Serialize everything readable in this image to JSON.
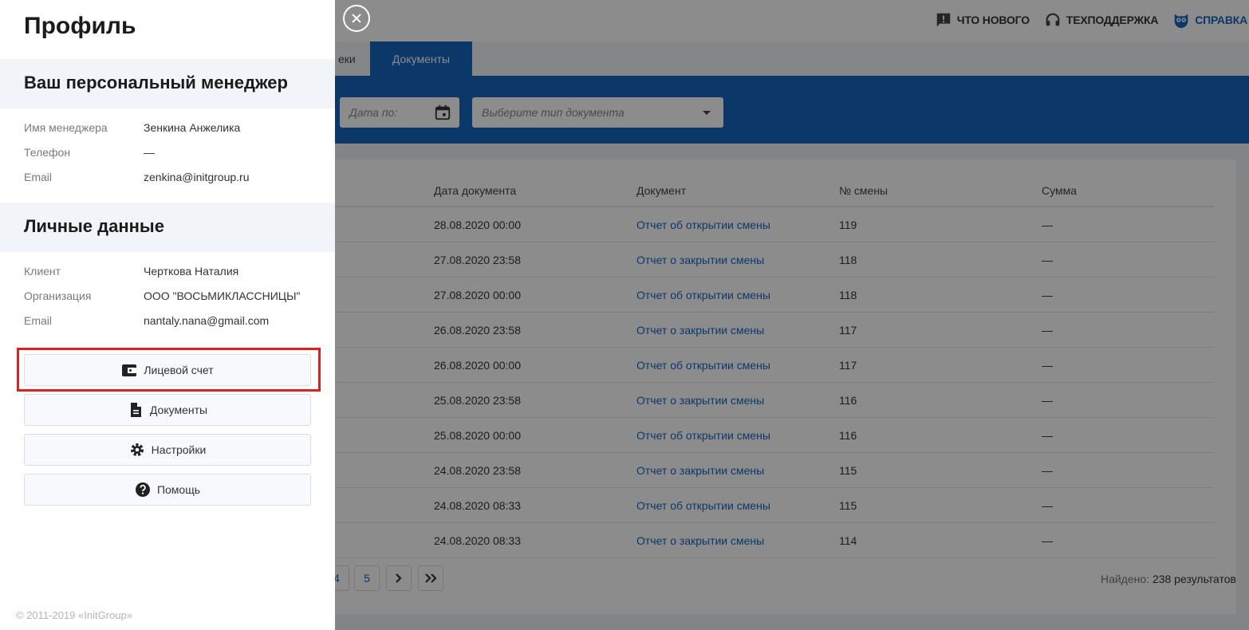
{
  "header": {
    "whats_new": "ЧТО НОВОГО",
    "support": "ТЕХПОДДЕРЖКА",
    "help": "СПРАВКА"
  },
  "tabs": [
    {
      "label": "еки"
    },
    {
      "label": "Документы"
    }
  ],
  "filters": {
    "date_to_placeholder": "Дата по:",
    "doc_type_placeholder": "Выберите тип документа"
  },
  "table": {
    "headers": [
      "Дата документа",
      "Документ",
      "№ смены",
      "Сумма"
    ],
    "rows": [
      {
        "date": "28.08.2020 00:00",
        "doc": "Отчет об открытии смены",
        "shift": "119",
        "sum": "—"
      },
      {
        "date": "27.08.2020 23:58",
        "doc": "Отчет о закрытии смены",
        "shift": "118",
        "sum": "—"
      },
      {
        "date": "27.08.2020 00:00",
        "doc": "Отчет об открытии смены",
        "shift": "118",
        "sum": "—"
      },
      {
        "date": "26.08.2020 23:58",
        "doc": "Отчет о закрытии смены",
        "shift": "117",
        "sum": "—"
      },
      {
        "date": "26.08.2020 00:00",
        "doc": "Отчет об открытии смены",
        "shift": "117",
        "sum": "—"
      },
      {
        "date": "25.08.2020 23:58",
        "doc": "Отчет о закрытии смены",
        "shift": "116",
        "sum": "—"
      },
      {
        "date": "25.08.2020 00:00",
        "doc": "Отчет об открытии смены",
        "shift": "116",
        "sum": "—"
      },
      {
        "date": "24.08.2020 23:58",
        "doc": "Отчет о закрытии смены",
        "shift": "115",
        "sum": "—"
      },
      {
        "date": "24.08.2020 08:33",
        "doc": "Отчет об открытии смены",
        "shift": "115",
        "sum": "—"
      },
      {
        "date": "24.08.2020 08:33",
        "doc": "Отчет о закрытии смены",
        "shift": "114",
        "sum": "—"
      }
    ]
  },
  "pagination": {
    "partial_page": "4",
    "page_5": "5",
    "next": "›",
    "last": "»",
    "found_label": "Найдено:",
    "found_value": "238 результатов"
  },
  "drawer": {
    "title": "Профиль",
    "manager_section": "Ваш персональный менеджер",
    "manager": [
      {
        "label": "Имя менеджера",
        "value": "Зенкина Анжелика"
      },
      {
        "label": "Телефон",
        "value": "—"
      },
      {
        "label": "Email",
        "value": "zenkina@initgroup.ru"
      }
    ],
    "personal_section": "Личные данные",
    "personal": [
      {
        "label": "Клиент",
        "value": "Черткова Наталия"
      },
      {
        "label": "Организация",
        "value": "ООО \"ВОСЬМИКЛАССНИЦЫ\""
      },
      {
        "label": "Email",
        "value": "nantaly.nana@gmail.com"
      }
    ],
    "buttons": {
      "account": "Лицевой счет",
      "documents": "Документы",
      "settings": "Настройки",
      "help": "Помощь"
    },
    "copyright": "© 2011-2019 «InitGroup»"
  },
  "colors": {
    "accent": "#1565c0",
    "highlight": "#e0201b"
  }
}
